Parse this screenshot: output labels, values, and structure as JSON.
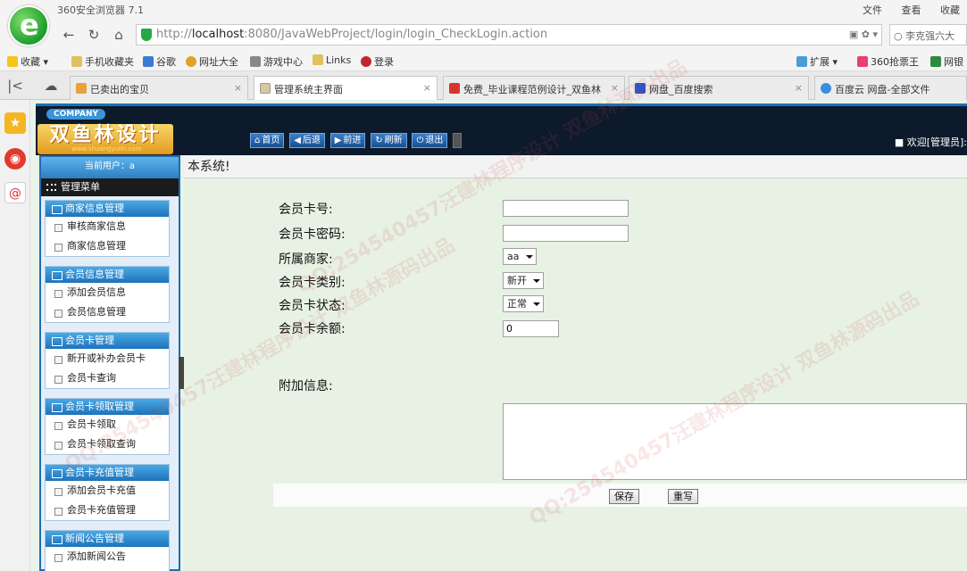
{
  "browser": {
    "title": "360安全浏览器 7.1",
    "top_links": [
      "文件",
      "查看",
      "收藏"
    ],
    "url_host": "localhost",
    "url_rest": ":8080/JavaWebProject/login/login_CheckLogin.action",
    "search_text": "李克强六大",
    "bookmarks": [
      "收藏",
      "手机收藏夹",
      "谷歌",
      "网址大全",
      "游戏中心",
      "Links",
      "登录"
    ],
    "bookmarks_right": [
      "扩展",
      "360抢票王",
      "网银"
    ],
    "tabs": [
      {
        "label": "已卖出的宝贝",
        "active": false
      },
      {
        "label": "管理系统主界面",
        "active": true
      },
      {
        "label": "免费_毕业课程范例设计_双鱼林",
        "active": false
      },
      {
        "label": "网盘_百度搜索",
        "active": false
      },
      {
        "label": "百度云 网盘-全部文件",
        "active": false
      }
    ]
  },
  "site": {
    "company_badge": "COMPANY",
    "logo_text": "双鱼林设计",
    "logo_url": "www.shuangyulin.com",
    "toolbar": [
      "首页",
      "后退",
      "前进",
      "刷新",
      "退出"
    ],
    "welcome": "■ 欢迎[管理员]:"
  },
  "sidebar": {
    "current_user": "当前用户：a",
    "menu_title": "管理菜单",
    "groups": [
      {
        "title": "商家信息管理",
        "items": [
          "审核商家信息",
          "商家信息管理"
        ]
      },
      {
        "title": "会员信息管理",
        "items": [
          "添加会员信息",
          "会员信息管理"
        ]
      },
      {
        "title": "会员卡管理",
        "items": [
          "新开或补办会员卡",
          "会员卡查询"
        ]
      },
      {
        "title": "会员卡领取管理",
        "items": [
          "会员卡领取",
          "会员卡领取查询"
        ]
      },
      {
        "title": "会员卡充值管理",
        "items": [
          "添加会员卡充值",
          "会员卡充值管理"
        ]
      },
      {
        "title": "新闻公告管理",
        "items": [
          "添加新闻公告"
        ]
      }
    ]
  },
  "content": {
    "crumb": "本系统!",
    "form": {
      "card_no_label": "会员卡号:",
      "card_no_value": "",
      "password_label": "会员卡密码:",
      "password_value": "",
      "merchant_label": "所属商家:",
      "merchant_value": "aa",
      "type_label": "会员卡类别:",
      "type_value": "新开",
      "status_label": "会员卡状态:",
      "status_value": "正常",
      "balance_label": "会员卡余额:",
      "balance_value": "0",
      "extra_label": "附加信息:"
    },
    "buttons": {
      "save": "保存",
      "reset": "重写"
    }
  },
  "watermark_text": "QQ:254540457汪建林程序设计 双鱼林源码出品",
  "colors": {
    "accent": "#1e6cb0",
    "page_bg": "#e7f2e4",
    "header_bg": "#0d1a2c"
  }
}
